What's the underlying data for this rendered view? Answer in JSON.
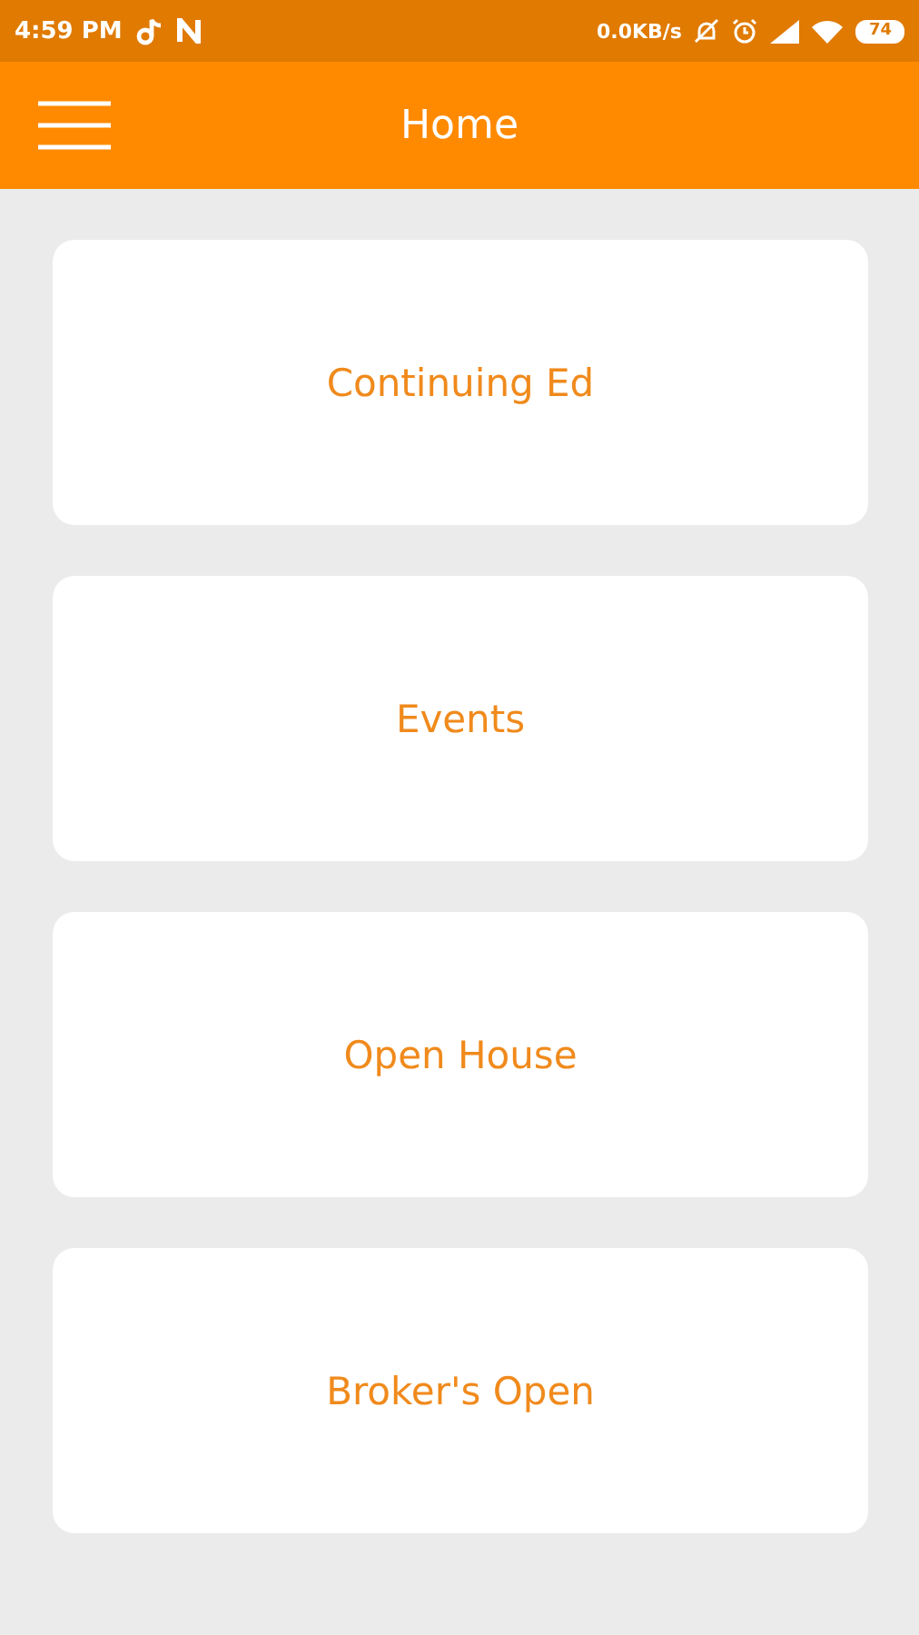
{
  "status_bar": {
    "time": "4:59 PM",
    "network_speed": "0.0KB/s",
    "battery": "74"
  },
  "app_bar": {
    "title": "Home"
  },
  "cards": [
    {
      "label": "Continuing Ed"
    },
    {
      "label": "Events"
    },
    {
      "label": "Open House"
    },
    {
      "label": "Broker's Open"
    }
  ]
}
